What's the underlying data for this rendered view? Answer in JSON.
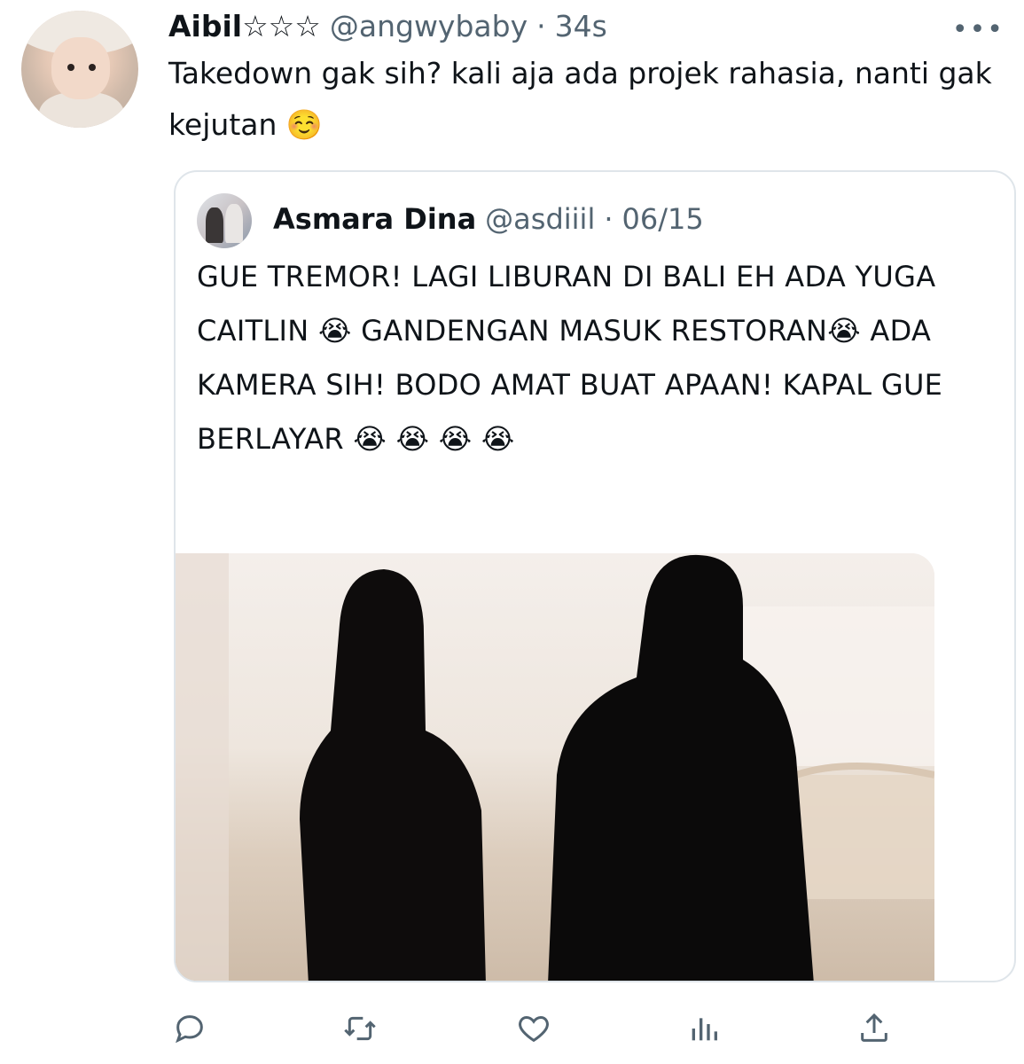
{
  "tweet": {
    "author_name": "Aibil☆☆☆",
    "author_handle": "@angwybaby",
    "separator": "·",
    "time": "34s",
    "more_label": "•••",
    "text": "Takedown gak sih? kali aja ada projek rahasia, nanti gak kejutan ☺️"
  },
  "quote": {
    "author_name": "Asmara Dina",
    "author_handle": "@asdiiil",
    "separator": "·",
    "date": "06/15",
    "text": "GUE TREMOR! LAGI LIBURAN DI BALI EH ADA YUGA CAITLIN 😭 GANDENGAN MASUK RESTORAN😭  ADA KAMERA SIH! BODO AMAT BUAT APAAN! KAPAL GUE BERLAYAR 😭 😭 😭 😭"
  },
  "actions": [
    {
      "icon": "reply-icon"
    },
    {
      "icon": "retweet-icon"
    },
    {
      "icon": "like-icon"
    },
    {
      "icon": "analytics-icon"
    },
    {
      "icon": "share-icon"
    }
  ],
  "colors": {
    "text": "#0f1419",
    "muted": "#536471",
    "border": "#dfe5ea"
  }
}
